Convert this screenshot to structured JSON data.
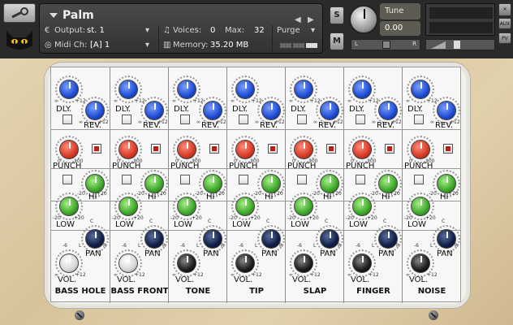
{
  "header": {
    "instrument": "Palm",
    "output_label": "Output:",
    "output_value": "st. 1",
    "voices_label": "Voices:",
    "voices_value": "0",
    "max_label": "Max:",
    "max_value": "32",
    "purge_label": "Purge",
    "midi_label": "Midi Ch:",
    "midi_value": "[A] 1",
    "memory_label": "Memory:",
    "memory_value": "35.20 MB",
    "solo_label": "S",
    "mute_label": "M",
    "tune_label": "Tune",
    "tune_value": "0.00",
    "pan_l": "L",
    "pan_r": "R",
    "aux_label": "AUX",
    "pv_label": "PV"
  },
  "channels": [
    {
      "name": "BASS HOLE",
      "vol_knob": "white"
    },
    {
      "name": "BASS FRONT",
      "vol_knob": "white"
    },
    {
      "name": "TONE",
      "vol_knob": "black"
    },
    {
      "name": "TIP",
      "vol_knob": "black"
    },
    {
      "name": "SLAP",
      "vol_knob": "black"
    },
    {
      "name": "FINGER",
      "vol_knob": "black"
    },
    {
      "name": "NOISE",
      "vol_knob": "black"
    }
  ],
  "labels": {
    "dly": "DLY.",
    "rev": "REV.",
    "punch": "PUNCH",
    "hi": "HI",
    "low": "LOW",
    "pan": "PAN",
    "vol": "VOL.",
    "inf": "∞",
    "plus12": "+12",
    "zero": "0",
    "hundred": "100",
    "minus20": "-20",
    "plus20": "+20",
    "l": "L",
    "r": "R",
    "c": "C",
    "minus6": "-6"
  },
  "colors": {
    "dly_knob": "#1e4ad0",
    "rev_knob": "#1e4ad0",
    "punch_knob": "#d53a26",
    "eq_knob": "#3ea62a",
    "pan_knob": "#0f1e45"
  }
}
